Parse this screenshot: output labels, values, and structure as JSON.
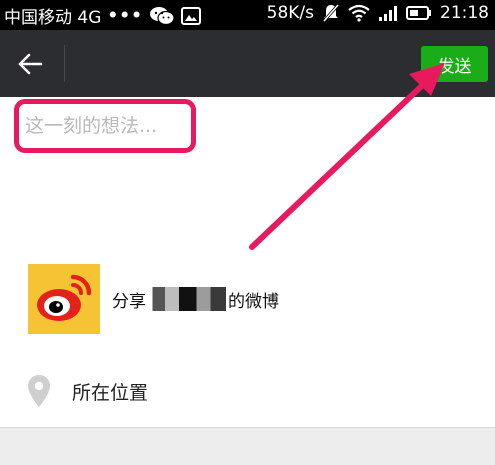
{
  "status_bar": {
    "carrier": "中国移动 4G",
    "dots": "•••",
    "speed": "58K/s",
    "time": "21:18"
  },
  "action_bar": {
    "send_label": "发送"
  },
  "composer": {
    "placeholder": "这一刻的想法..."
  },
  "share": {
    "prefix": "分享",
    "suffix": "的微博"
  },
  "location": {
    "label": "所在位置"
  },
  "colors": {
    "accent_green": "#1aad19",
    "highlight_pink": "#e8195c",
    "action_bar": "#2b2d31",
    "weibo_yellow": "#f6c335"
  }
}
